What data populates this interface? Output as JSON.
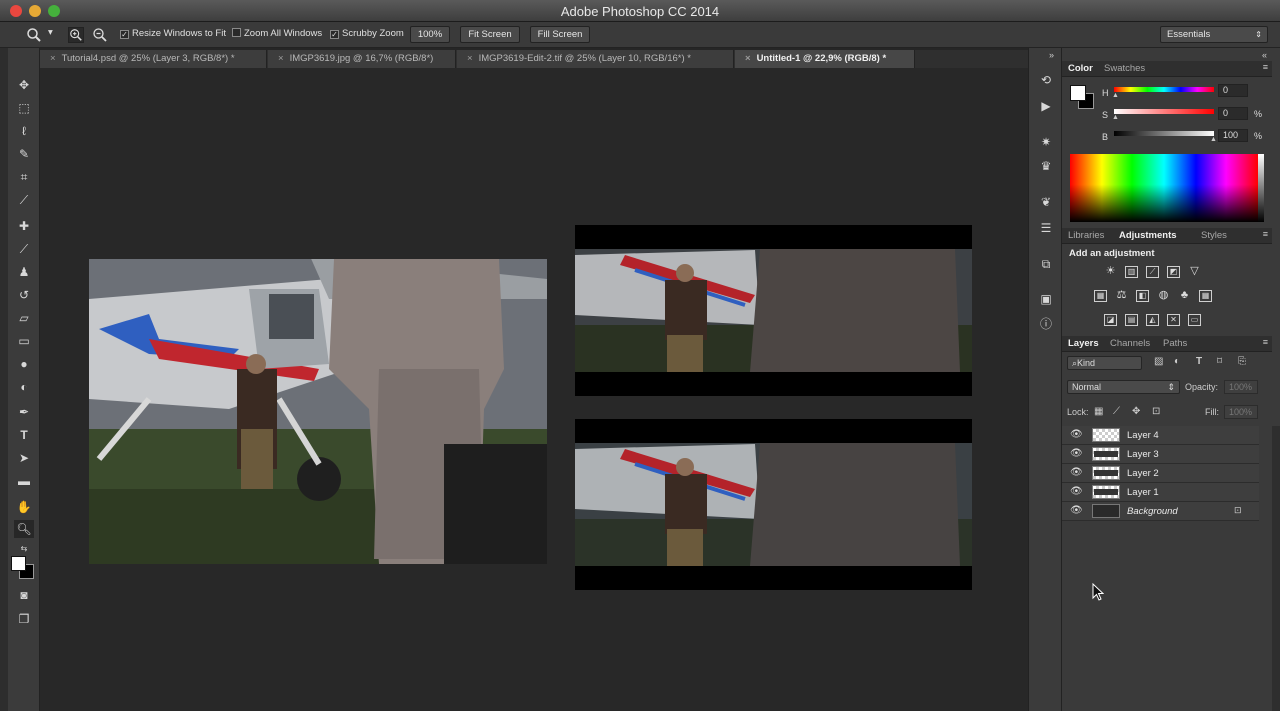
{
  "window": {
    "title": "Adobe Photoshop CC 2014"
  },
  "options_bar": {
    "resize_windows": "Resize Windows to Fit",
    "zoom_all": "Zoom All Windows",
    "scrubby_zoom": "Scrubby Zoom",
    "zoom_value": "100%",
    "fit_screen": "Fit Screen",
    "fill_screen": "Fill Screen",
    "workspace": "Essentials",
    "checkmark": "✓"
  },
  "tabs": [
    {
      "label": "Tutorial4.psd @ 25% (Layer 3, RGB/8*) *",
      "close": "×"
    },
    {
      "label": "IMGP3619.jpg @ 16,7% (RGB/8*)",
      "close": "×"
    },
    {
      "label": "IMGP3619-Edit-2.tif @ 25% (Layer 10, RGB/16*) *",
      "close": "×"
    },
    {
      "label": "Untitled-1 @ 22,9% (RGB/8) *",
      "close": "×"
    }
  ],
  "color_panel": {
    "tabs": [
      "Color",
      "Swatches"
    ],
    "h_label": "H",
    "h_value": "0",
    "s_label": "S",
    "s_value": "0",
    "s_unit": "%",
    "b_label": "B",
    "b_value": "100",
    "b_unit": "%",
    "foreground": "#ffffff",
    "background": "#000000"
  },
  "adjustments_panel": {
    "tabs": [
      "Libraries",
      "Adjustments",
      "Styles"
    ],
    "heading": "Add an adjustment"
  },
  "layers_panel": {
    "tabs": [
      "Layers",
      "Channels",
      "Paths"
    ],
    "filter": "Kind",
    "blend_mode": "Normal",
    "opacity_label": "Opacity:",
    "opacity_value": "100%",
    "lock_label": "Lock:",
    "fill_label": "Fill:",
    "fill_value": "100%",
    "layers": [
      {
        "name": "Layer 4"
      },
      {
        "name": "Layer 3"
      },
      {
        "name": "Layer 2"
      },
      {
        "name": "Layer 1"
      },
      {
        "name": "Background"
      }
    ]
  },
  "icons": {
    "eye": "👁",
    "lock": "🔒",
    "menu": "≡",
    "collapse": "«",
    "expand": "»"
  }
}
